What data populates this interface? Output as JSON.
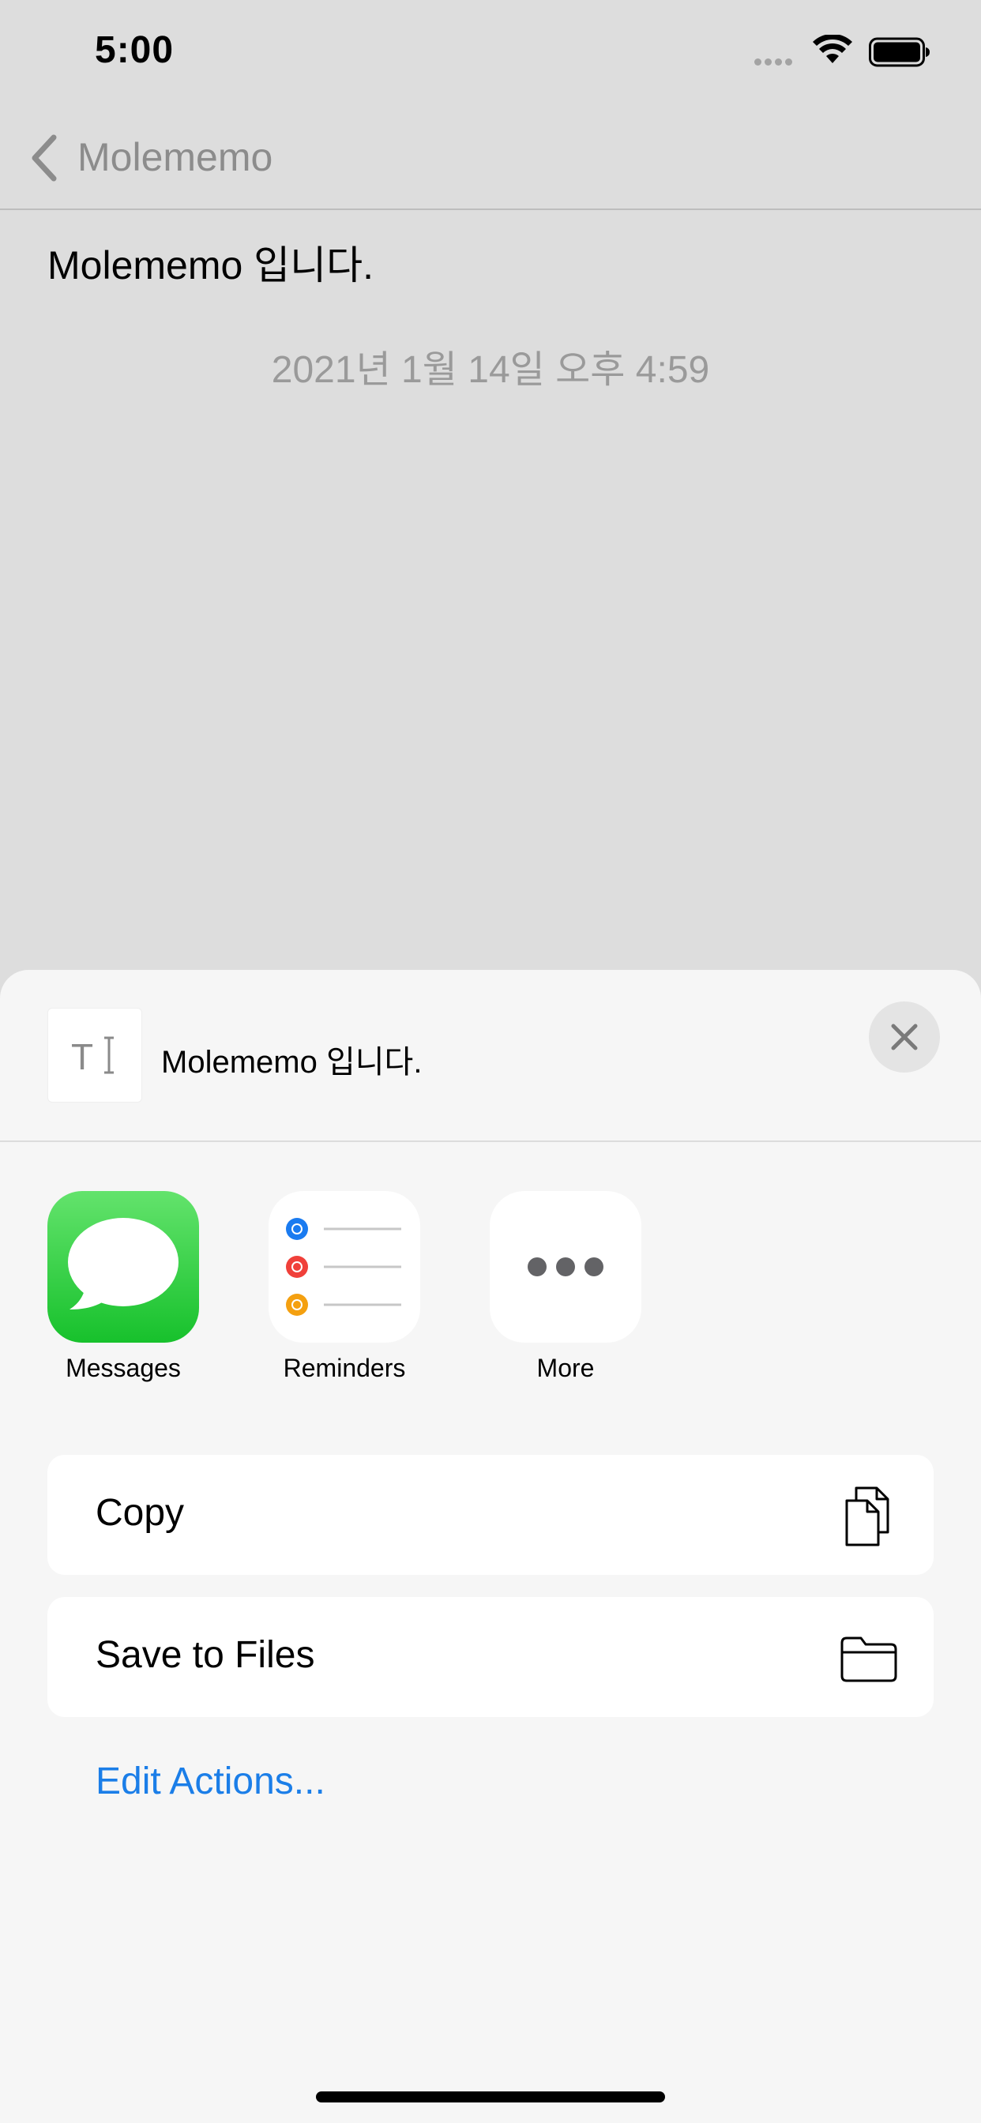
{
  "status_bar": {
    "time": "5:00"
  },
  "nav": {
    "back_label": "Molememo"
  },
  "note": {
    "text": "Molememo 입니다.",
    "date": "2021년 1월 14일 오후 4:59"
  },
  "share_sheet": {
    "preview_title": "Molememo 입니다.",
    "preview_icon": "text-cursor-icon",
    "close_icon": "close-icon",
    "apps": [
      {
        "label": "Messages",
        "icon": "messages-icon"
      },
      {
        "label": "Reminders",
        "icon": "reminders-icon"
      },
      {
        "label": "More",
        "icon": "more-icon"
      }
    ],
    "actions": [
      {
        "label": "Copy",
        "icon": "copy-icon"
      },
      {
        "label": "Save to Files",
        "icon": "folder-icon"
      }
    ],
    "edit_actions_label": "Edit Actions...",
    "colors": {
      "link": "#1b7ee8",
      "messages_green": "#28c840",
      "reminder_blue": "#1a7bf0",
      "reminder_red": "#f0403a",
      "reminder_orange": "#f4a010"
    }
  }
}
